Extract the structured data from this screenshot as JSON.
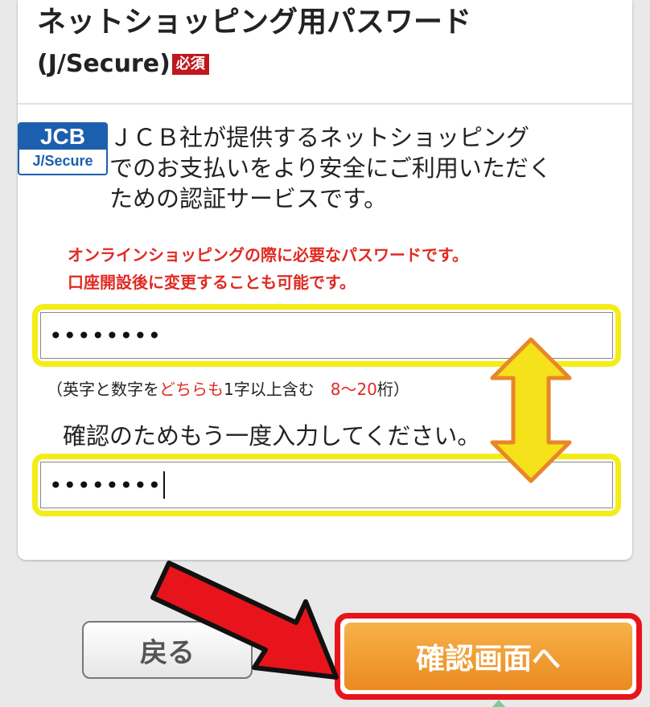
{
  "header": {
    "title": "ネットショッピング用パスワード",
    "title_sub": "(J/Secure)",
    "required_badge": "必須"
  },
  "logo": {
    "top": "JCB",
    "bottom": "J/Secure"
  },
  "description": {
    "line1": "ＪＣＢ社が提供するネットショッピング",
    "line2": "でのお支払いをより安全にご利用いただく",
    "line3": "ための認証サービスです。"
  },
  "notice": {
    "line1": "オンラインショッピングの際に必要なパスワードです。",
    "line2": "口座開設後に変更することも可能です。"
  },
  "password": {
    "value": "••••••••"
  },
  "rule": {
    "prefix": "（英字と数字を",
    "emph": "どちらも",
    "middle": "1字以上含む　",
    "range": "8〜20",
    "suffix": "桁）"
  },
  "confirm": {
    "label": "確認のためもう一度入力してください。",
    "value": "••••••••"
  },
  "buttons": {
    "back": "戻る",
    "next": "確認画面へ"
  },
  "colors": {
    "highlight_yellow": "#f4ec18",
    "arrow_orange": "#e8862a",
    "pointer_red": "#e8141b",
    "required_red": "#c0171f",
    "jcb_blue": "#1b5fae",
    "notice_red": "#e02a22"
  },
  "icons": {
    "double_arrow": "up-down-arrow-icon",
    "pointer_arrow": "arrow-pointer-icon"
  }
}
